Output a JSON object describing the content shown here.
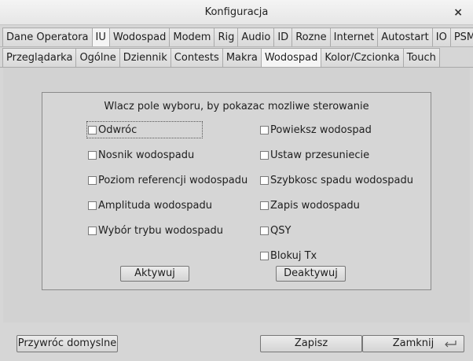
{
  "window": {
    "title": "Konfiguracja",
    "close_glyph": "×"
  },
  "main_tabs": [
    {
      "label": "Dane Operatora",
      "active": false
    },
    {
      "label": "IU",
      "active": true
    },
    {
      "label": "Wodospad",
      "active": false
    },
    {
      "label": "Modem",
      "active": false
    },
    {
      "label": "Rig",
      "active": false
    },
    {
      "label": "Audio",
      "active": false
    },
    {
      "label": "ID",
      "active": false
    },
    {
      "label": "Rozne",
      "active": false
    },
    {
      "label": "Internet",
      "active": false
    },
    {
      "label": "Autostart",
      "active": false
    },
    {
      "label": "IO",
      "active": false
    },
    {
      "label": "PSM",
      "active": false
    }
  ],
  "sub_tabs": [
    {
      "label": "Przeglądarka",
      "active": false
    },
    {
      "label": "Ogólne",
      "active": false
    },
    {
      "label": "Dziennik",
      "active": false
    },
    {
      "label": "Contests",
      "active": false
    },
    {
      "label": "Makra",
      "active": false
    },
    {
      "label": "Wodospad",
      "active": true
    },
    {
      "label": "Kolor/Czcionka",
      "active": false
    },
    {
      "label": "Touch",
      "active": false
    }
  ],
  "group": {
    "title": "Wlacz pole wyboru, by pokazac mozliwe sterowanie",
    "left_checks": [
      {
        "label": "Odwróc",
        "checked": false
      },
      {
        "label": "Nosnik wodospadu",
        "checked": false
      },
      {
        "label": "Poziom referencji wodospadu",
        "checked": false
      },
      {
        "label": "Amplituda wodospadu",
        "checked": false
      },
      {
        "label": "Wybór trybu wodospadu",
        "checked": false
      }
    ],
    "right_checks": [
      {
        "label": "Powieksz wodospad",
        "checked": false
      },
      {
        "label": "Ustaw przesuniecie",
        "checked": false
      },
      {
        "label": "Szybkosc spadu wodospadu",
        "checked": false
      },
      {
        "label": "Zapis wodospadu",
        "checked": false
      },
      {
        "label": "QSY",
        "checked": false
      },
      {
        "label": "Blokuj Tx",
        "checked": false
      }
    ],
    "activate_label": "Aktywuj",
    "deactivate_label": "Deaktywuj"
  },
  "footer": {
    "restore_label": "Przywróc domyslne",
    "save_label": "Zapisz",
    "close_label": "Zamknij"
  }
}
